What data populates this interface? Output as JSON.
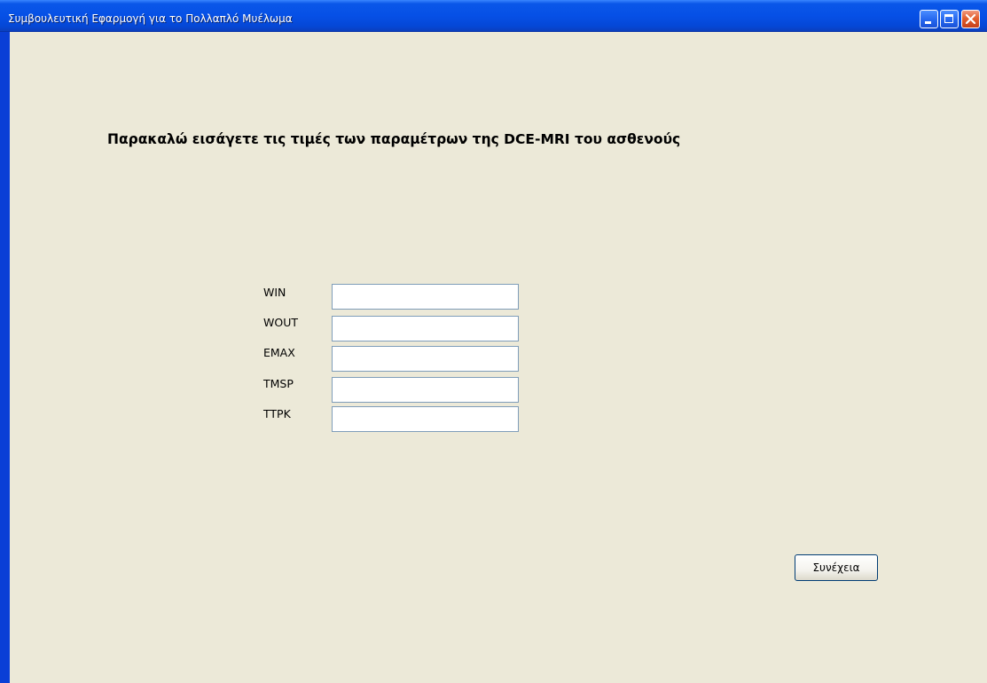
{
  "window": {
    "title": "Συμβουλευτική Εφαρμογή για το Πολλαπλό Μυέλωμα"
  },
  "form": {
    "heading": "Παρακαλώ εισάγετε τις τιμές των παραμέτρων της DCE-MRI του ασθενούς",
    "fields": [
      {
        "label": "WIN",
        "value": ""
      },
      {
        "label": "WOUT",
        "value": ""
      },
      {
        "label": "EMAX",
        "value": ""
      },
      {
        "label": "TMSP",
        "value": ""
      },
      {
        "label": "TTPK",
        "value": ""
      }
    ],
    "continue_label": "Συνέχεια"
  },
  "icons": {
    "minimize": "minimize-icon",
    "maximize": "maximize-icon",
    "close": "close-icon"
  },
  "colors": {
    "titlebar": "#0650e6",
    "client_background": "#ece9d8",
    "close_button": "#e4602e"
  }
}
